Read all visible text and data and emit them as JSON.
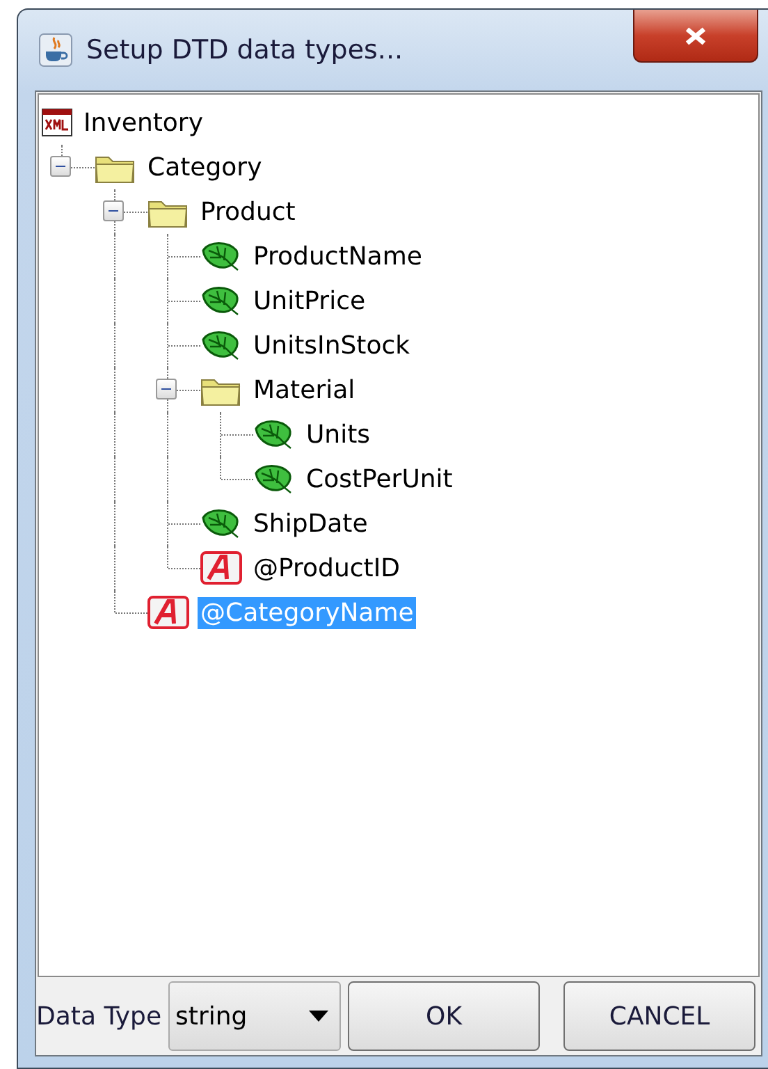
{
  "window": {
    "title": "Setup DTD data types..."
  },
  "tree": [
    {
      "label": "Inventory",
      "kind": "root",
      "selected": false,
      "children": [
        {
          "label": "Category",
          "kind": "folder",
          "selected": false,
          "expanded": true,
          "children": [
            {
              "label": "Product",
              "kind": "folder",
              "selected": false,
              "expanded": true,
              "children": [
                {
                  "label": "ProductName",
                  "kind": "leaf",
                  "selected": false
                },
                {
                  "label": "UnitPrice",
                  "kind": "leaf",
                  "selected": false
                },
                {
                  "label": "UnitsInStock",
                  "kind": "leaf",
                  "selected": false
                },
                {
                  "label": "Material",
                  "kind": "folder",
                  "selected": false,
                  "expanded": true,
                  "children": [
                    {
                      "label": "Units",
                      "kind": "leaf",
                      "selected": false
                    },
                    {
                      "label": "CostPerUnit",
                      "kind": "leaf",
                      "selected": false
                    }
                  ]
                },
                {
                  "label": "ShipDate",
                  "kind": "leaf",
                  "selected": false
                },
                {
                  "label": "@ProductID",
                  "kind": "attribute",
                  "selected": false
                }
              ]
            },
            {
              "label": "@CategoryName",
              "kind": "attribute",
              "selected": true
            }
          ]
        }
      ]
    }
  ],
  "footer": {
    "label": "Data Type",
    "combo": "string",
    "buttons": [
      "OK",
      "CANCEL"
    ]
  }
}
